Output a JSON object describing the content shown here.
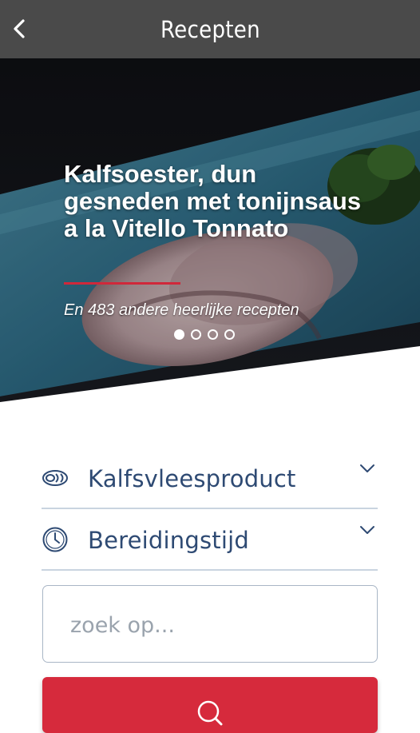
{
  "header": {
    "title": "Recepten",
    "back_icon": "chevron-left-icon"
  },
  "hero": {
    "title": "Kalfsoester, dun gesneden met tonijnsaus a la Vitello Tonnato",
    "subtitle": "En 483 andere heerlijke recepten",
    "accent_color": "#d0283a",
    "slides_total": 4,
    "active_slide": 1
  },
  "filters": {
    "product": {
      "label": "Kalfsvleesproduct",
      "icon": "meat-icon",
      "chevron": "chevron-down-icon"
    },
    "time": {
      "label": "Bereidingstijd",
      "icon": "clock-icon",
      "chevron": "chevron-down-icon"
    }
  },
  "search": {
    "placeholder": "zoek op...",
    "value": "",
    "button_icon": "search-icon",
    "button_color": "#d62a3c"
  }
}
